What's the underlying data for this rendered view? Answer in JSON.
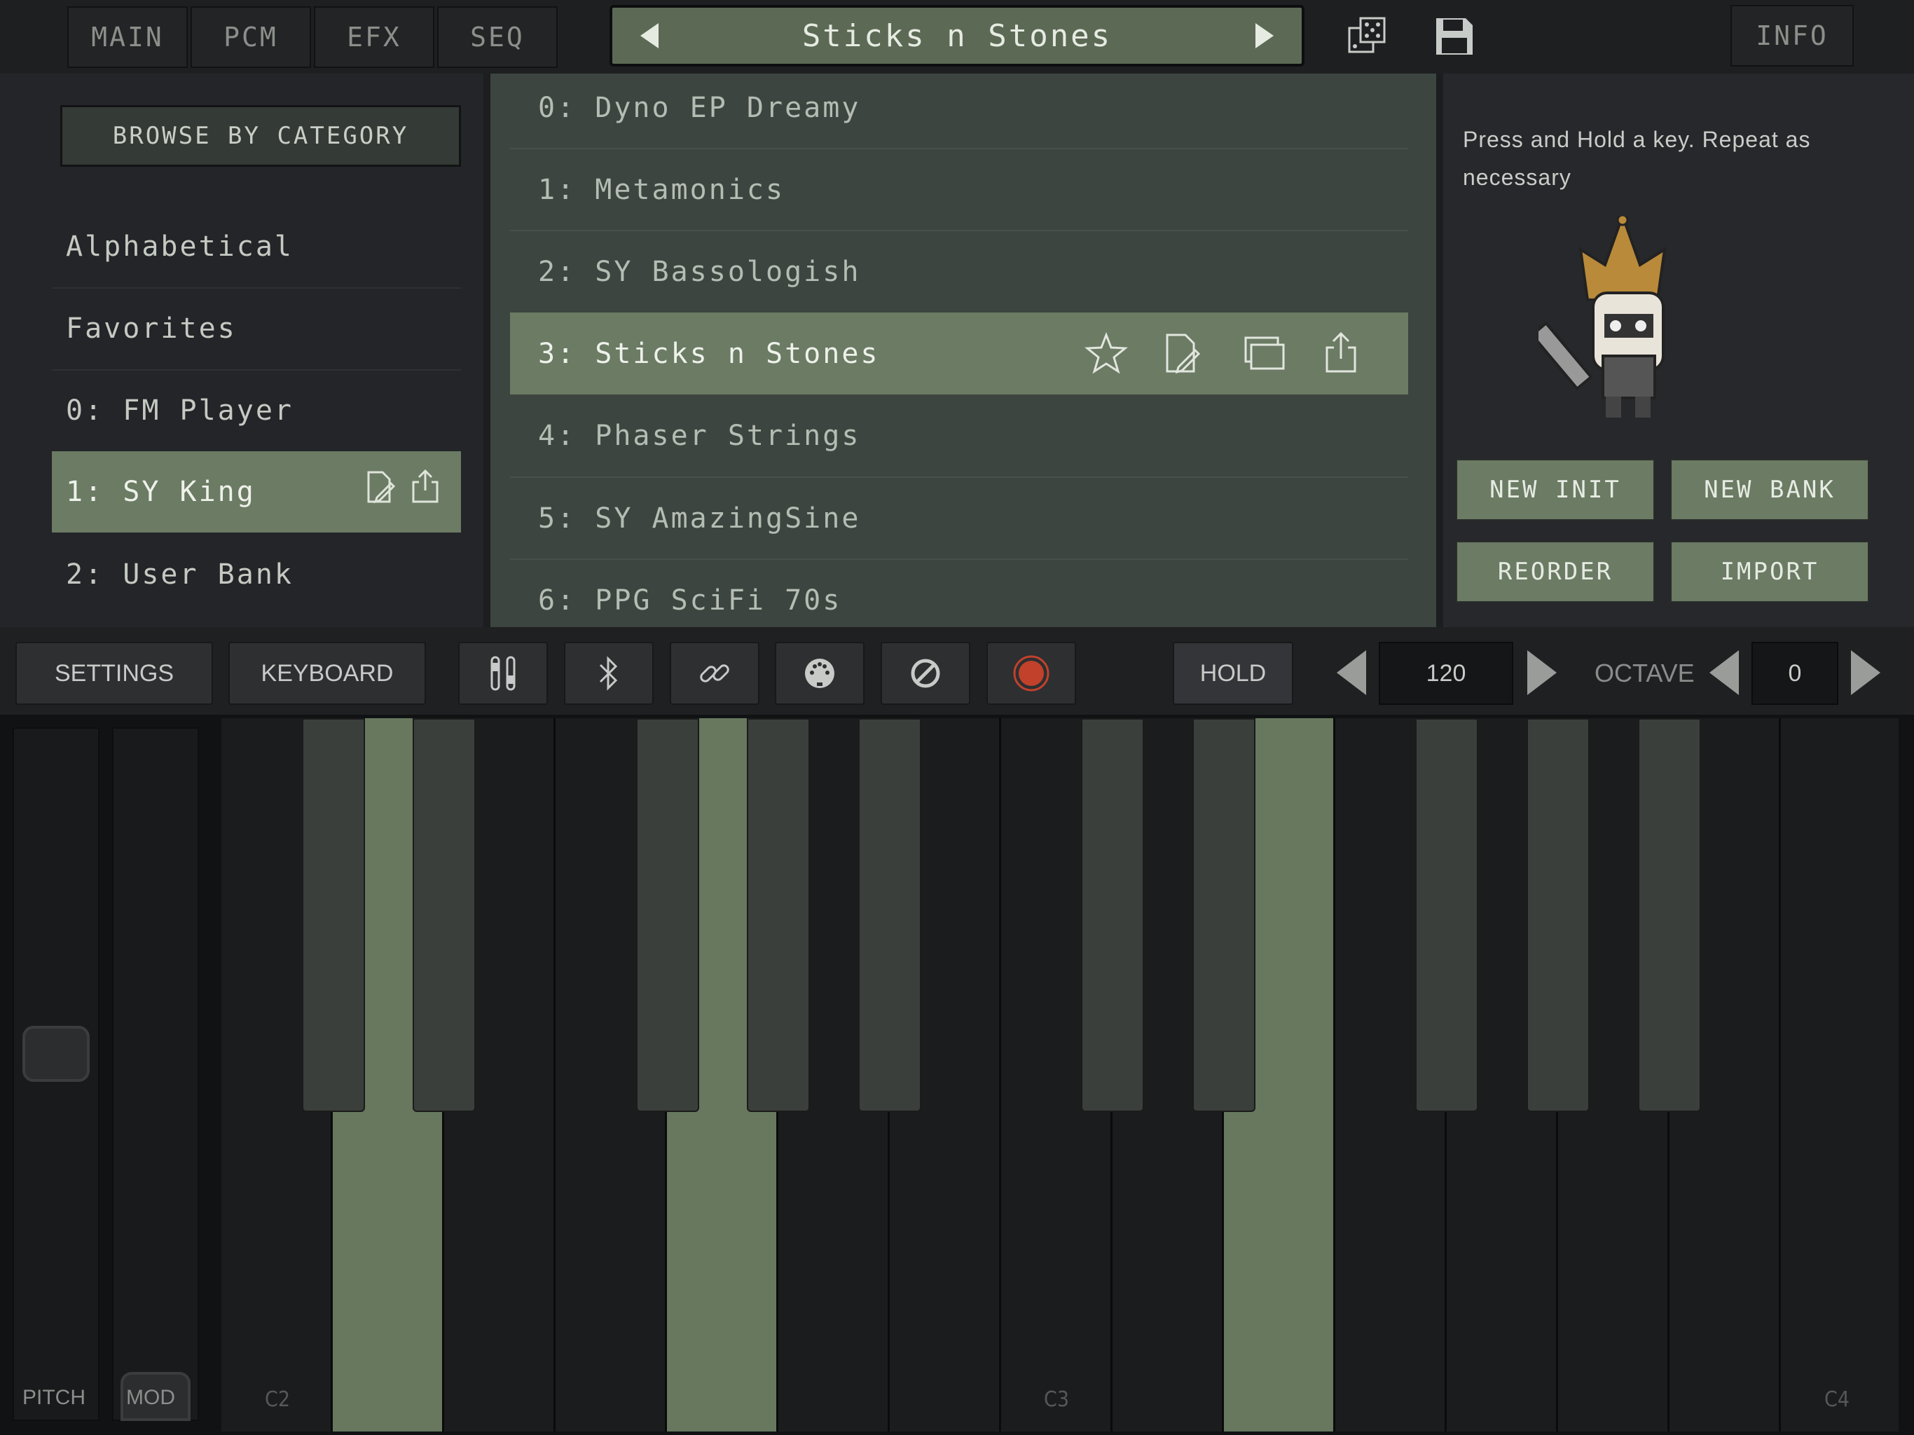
{
  "tabs": [
    "MAIN",
    "PCM",
    "EFX",
    "SEQ"
  ],
  "preset_title": "Sticks n Stones",
  "info_label": "INFO",
  "browse_label": "BROWSE BY CATEGORY",
  "categories": [
    "Alphabetical",
    "Favorites",
    "0: FM Player",
    "1: SY King",
    "2: User Bank"
  ],
  "presets": [
    "0: Dyno EP Dreamy",
    "1: Metamonics",
    "2: SY Bassologish",
    "3: Sticks n Stones",
    "4: Phaser Strings",
    "5: SY AmazingSine",
    "6: PPG SciFi 70s"
  ],
  "hint": "Press and Hold a key. Repeat as necessary",
  "buttons": {
    "new_init": "NEW INIT",
    "new_bank": "NEW BANK",
    "reorder": "REORDER",
    "import": "IMPORT"
  },
  "controls": {
    "settings": "SETTINGS",
    "keyboard": "KEYBOARD",
    "hold": "HOLD",
    "tempo": "120",
    "octave_label": "OCTAVE",
    "octave": "0"
  },
  "wheels": {
    "pitch": "PITCH",
    "mod": "MOD"
  },
  "notes": {
    "c2": "C2",
    "c3": "C3",
    "c4": "C4"
  },
  "colors": {
    "accent": "#6b7b64",
    "record": "#c2412b"
  }
}
